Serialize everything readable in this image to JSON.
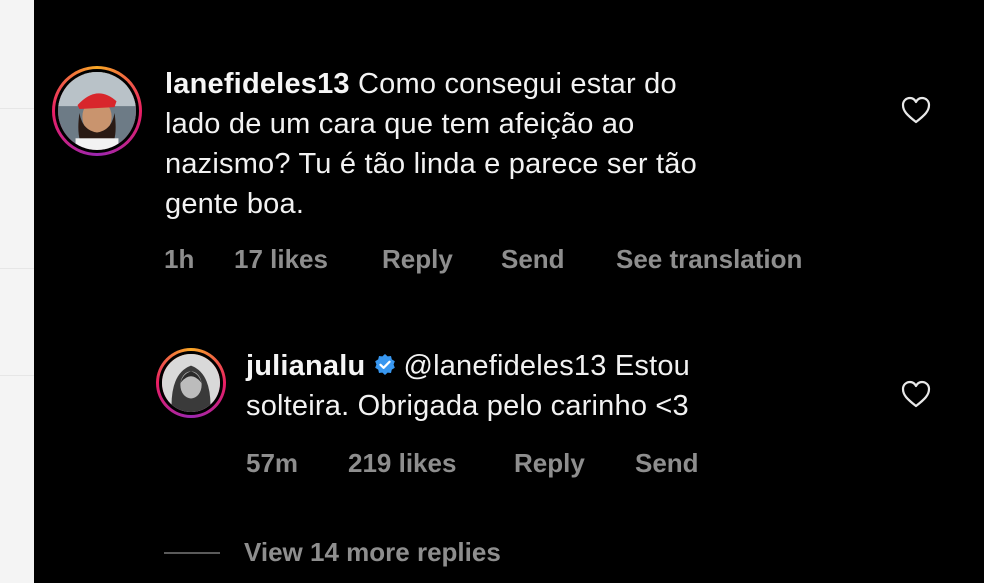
{
  "comment": {
    "username": "lanefideles13",
    "text_lines": [
      "Como consegui estar do",
      "lado de um cara que tem afeição ao",
      "nazismo? Tu é tão linda e parece ser tão",
      "gente boa."
    ],
    "time": "1h",
    "likes": "17 likes",
    "reply_label": "Reply",
    "send_label": "Send",
    "translate_label": "See translation",
    "like_icon": "heart-outline-icon"
  },
  "reply": {
    "username": "julianalu",
    "verified_icon": "verified-badge-icon",
    "text_lines": [
      "@lanefideles13 Estou",
      "solteira. Obrigada pelo carinho <3"
    ],
    "time": "57m",
    "likes": "219 likes",
    "reply_label": "Reply",
    "send_label": "Send",
    "like_icon": "heart-outline-icon"
  },
  "view_more": {
    "label": "View 14 more replies"
  },
  "colors": {
    "background": "#000000",
    "primary_text": "#f5f5f5",
    "secondary_text": "#8e8e8e",
    "verified_blue": "#3897f0"
  }
}
